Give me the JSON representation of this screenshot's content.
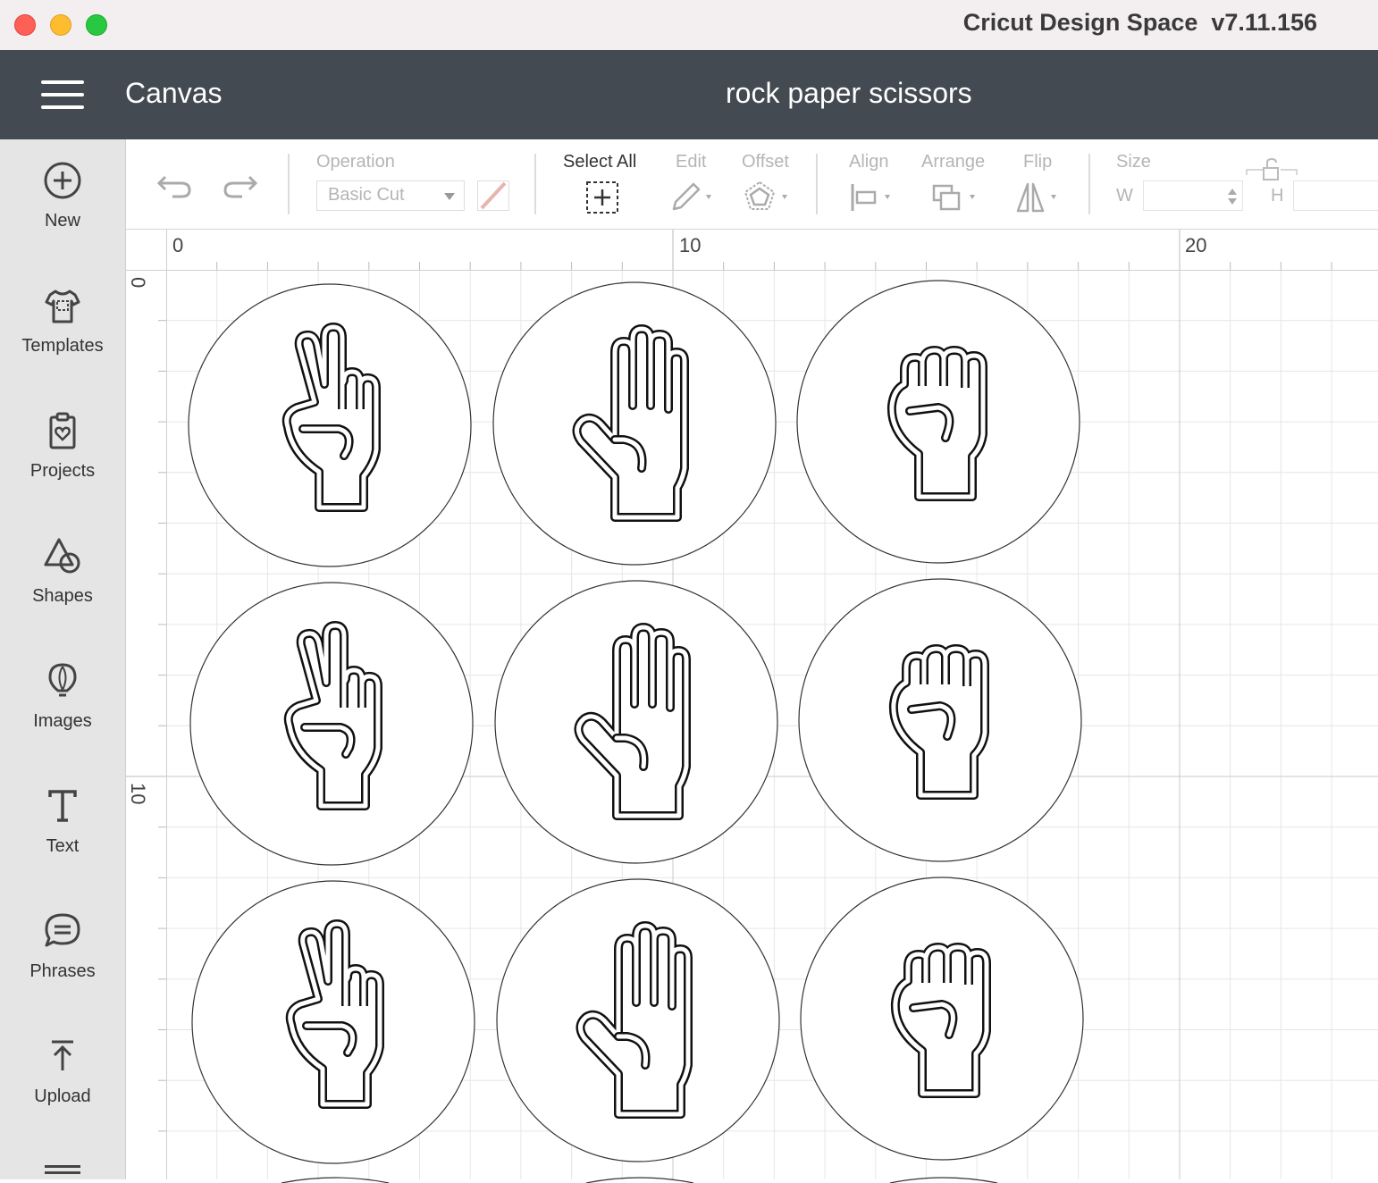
{
  "app": {
    "title": "Cricut Design Space  v7.11.156"
  },
  "header": {
    "section": "Canvas",
    "project_name": "rock paper scissors"
  },
  "sidebar": {
    "items": [
      {
        "label": "New",
        "icon": "plus-circle-icon"
      },
      {
        "label": "Templates",
        "icon": "tshirt-icon"
      },
      {
        "label": "Projects",
        "icon": "clipboard-heart-icon"
      },
      {
        "label": "Shapes",
        "icon": "shapes-icon"
      },
      {
        "label": "Images",
        "icon": "lightbulb-icon"
      },
      {
        "label": "Text",
        "icon": "text-t-icon"
      },
      {
        "label": "Phrases",
        "icon": "speech-bubble-icon"
      },
      {
        "label": "Upload",
        "icon": "upload-arrow-icon"
      }
    ]
  },
  "toolbar": {
    "operation_label": "Operation",
    "operation_value": "Basic Cut",
    "select_all_label": "Select All",
    "edit_label": "Edit",
    "offset_label": "Offset",
    "align_label": "Align",
    "arrange_label": "Arrange",
    "flip_label": "Flip",
    "size_label": "Size",
    "w_label": "W",
    "h_label": "H",
    "w_value": "",
    "h_value": "",
    "operation_color": "#e8b4ae"
  },
  "rulers": {
    "top_labels": [
      "0",
      "10",
      "20"
    ],
    "left_labels": [
      "0",
      "10"
    ]
  },
  "canvas": {
    "design_rows": [
      [
        "scissors-hand",
        "paper-hand",
        "rock-fist"
      ],
      [
        "scissors-hand",
        "paper-hand",
        "rock-fist"
      ],
      [
        "scissors-hand",
        "paper-hand",
        "rock-fist"
      ]
    ]
  }
}
